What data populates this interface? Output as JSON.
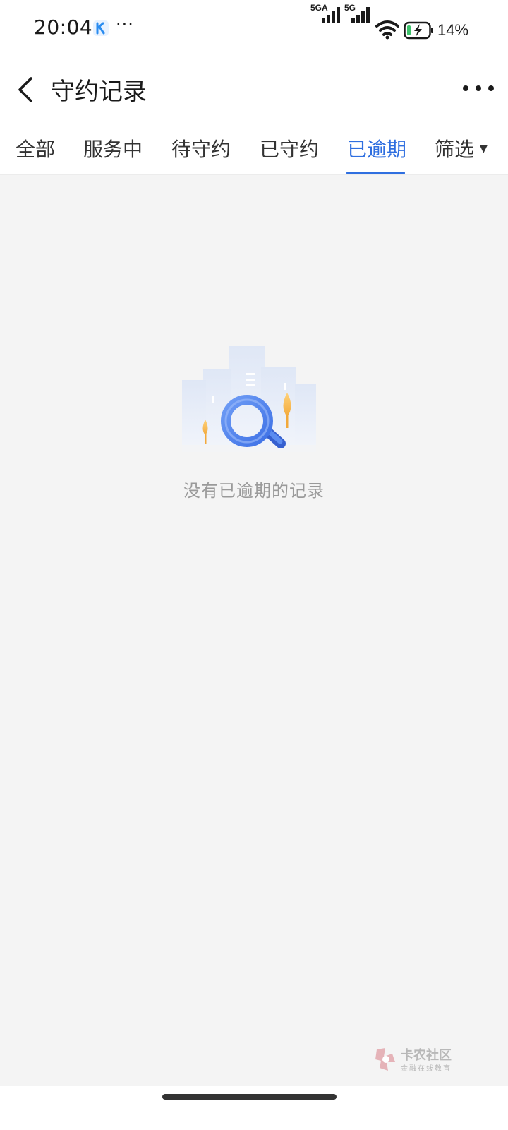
{
  "status_bar": {
    "time": "20:04",
    "more": "···",
    "sim1_label": "5GA",
    "sim2_label": "5G",
    "battery_percent": "14%",
    "battery_level": 0.14
  },
  "header": {
    "title": "守约记录"
  },
  "tabs": [
    {
      "label": "全部",
      "active": false
    },
    {
      "label": "服务中",
      "active": false
    },
    {
      "label": "待守约",
      "active": false
    },
    {
      "label": "已守约",
      "active": false
    },
    {
      "label": "已逾期",
      "active": true
    },
    {
      "label": "筛选",
      "active": false
    }
  ],
  "empty_state": {
    "message": "没有已逾期的记录"
  },
  "watermark": {
    "title": "卡农社区",
    "subtitle": "金融在线教育"
  },
  "colors": {
    "accent": "#2f6fe0",
    "text_primary": "#333333",
    "text_muted": "#9a9a9a",
    "background": "#f4f4f4"
  }
}
